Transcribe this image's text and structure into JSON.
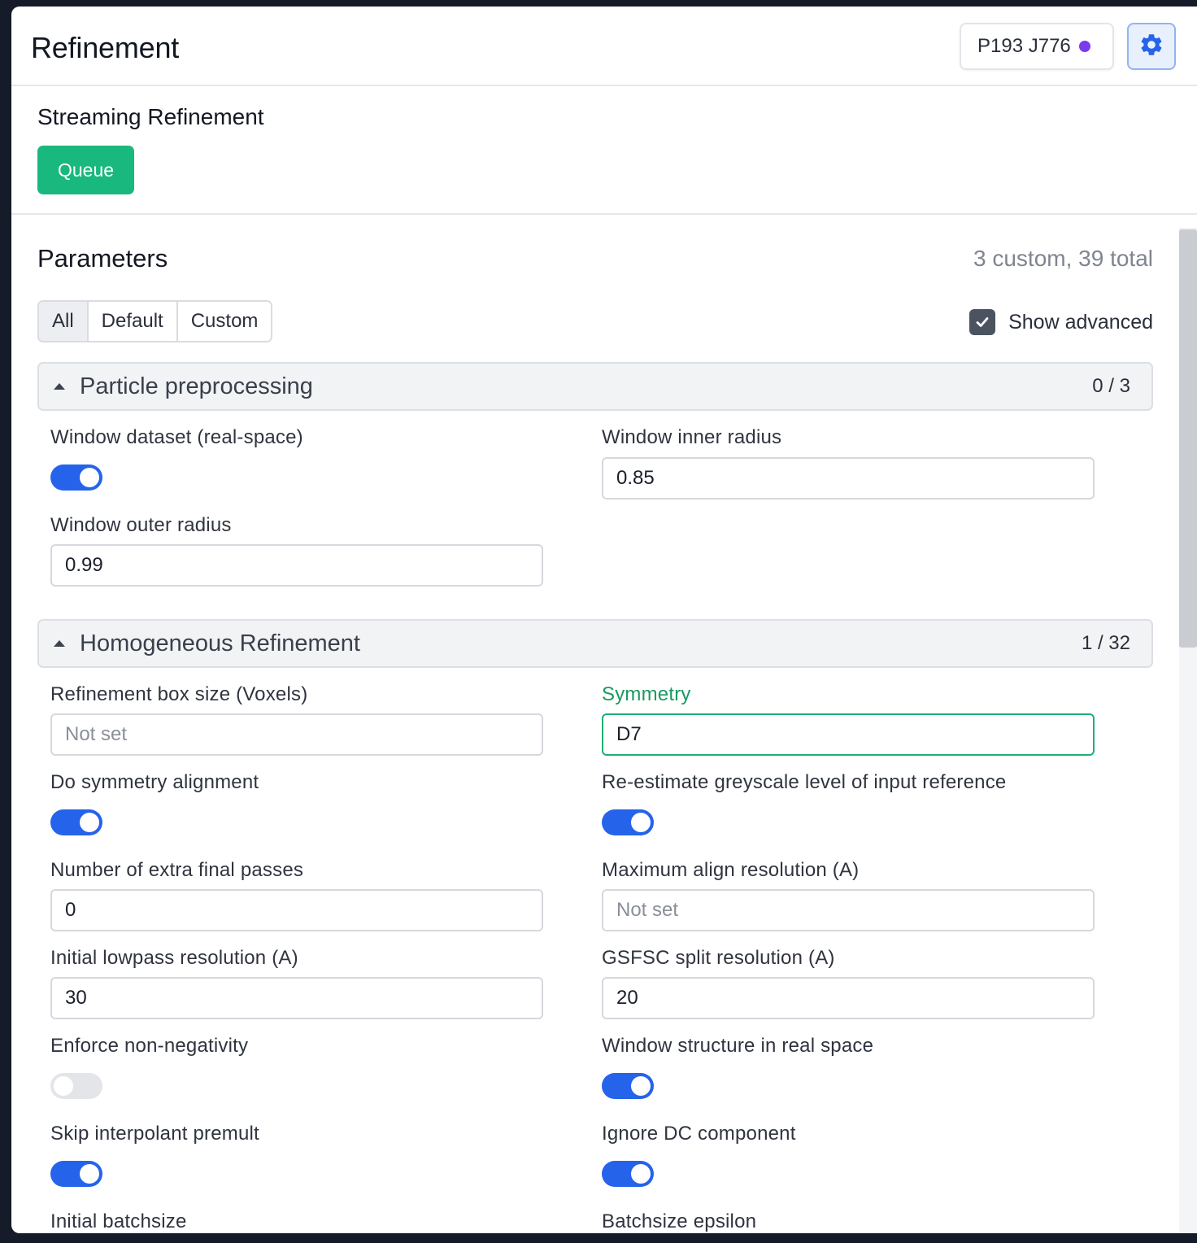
{
  "header": {
    "title": "Refinement",
    "job_badge": "P193 J776",
    "status_dot_color": "#7c3aed",
    "settings_icon": "gear-icon"
  },
  "streaming": {
    "title": "Streaming Refinement",
    "queue_label": "Queue",
    "queue_color": "#19b87e"
  },
  "parameters": {
    "title": "Parameters",
    "count": "3 custom, 39 total",
    "filters": [
      "All",
      "Default",
      "Custom"
    ],
    "active_filter": "All",
    "show_advanced_label": "Show advanced",
    "show_advanced_checked": true
  },
  "sections": [
    {
      "title": "Particle preprocessing",
      "count": "0 / 3",
      "fields": [
        {
          "label": "Window dataset (real-space)",
          "type": "toggle",
          "on": true
        },
        {
          "label": "Window inner radius",
          "type": "input",
          "value": "0.85",
          "placeholder": ""
        },
        {
          "label": "Window outer radius",
          "type": "input",
          "value": "0.99",
          "placeholder": ""
        }
      ]
    },
    {
      "title": "Homogeneous Refinement",
      "count": "1 / 32",
      "fields": [
        {
          "label": "Refinement box size (Voxels)",
          "type": "input",
          "value": "",
          "placeholder": "Not set"
        },
        {
          "label": "Symmetry",
          "type": "input",
          "value": "D7",
          "placeholder": "",
          "custom": true
        },
        {
          "label": "Do symmetry alignment",
          "type": "toggle",
          "on": true
        },
        {
          "label": "Re-estimate greyscale level of input reference",
          "type": "toggle",
          "on": true
        },
        {
          "label": "Number of extra final passes",
          "type": "input",
          "value": "0",
          "placeholder": ""
        },
        {
          "label": "Maximum align resolution (A)",
          "type": "input",
          "value": "",
          "placeholder": "Not set"
        },
        {
          "label": "Initial lowpass resolution (A)",
          "type": "input",
          "value": "30",
          "placeholder": ""
        },
        {
          "label": "GSFSC split resolution (A)",
          "type": "input",
          "value": "20",
          "placeholder": ""
        },
        {
          "label": "Enforce non-negativity",
          "type": "toggle",
          "on": false
        },
        {
          "label": "Window structure in real space",
          "type": "toggle",
          "on": true
        },
        {
          "label": "Skip interpolant premult",
          "type": "toggle",
          "on": true
        },
        {
          "label": "Ignore DC component",
          "type": "toggle",
          "on": true
        },
        {
          "label": "Initial batchsize",
          "type": "input",
          "value": "",
          "placeholder": ""
        },
        {
          "label": "Batchsize epsilon",
          "type": "input",
          "value": "",
          "placeholder": ""
        }
      ]
    }
  ],
  "colors": {
    "toggle_on": "#2563eb",
    "toggle_off": "#e3e5e9",
    "custom_accent": "#189a62"
  }
}
